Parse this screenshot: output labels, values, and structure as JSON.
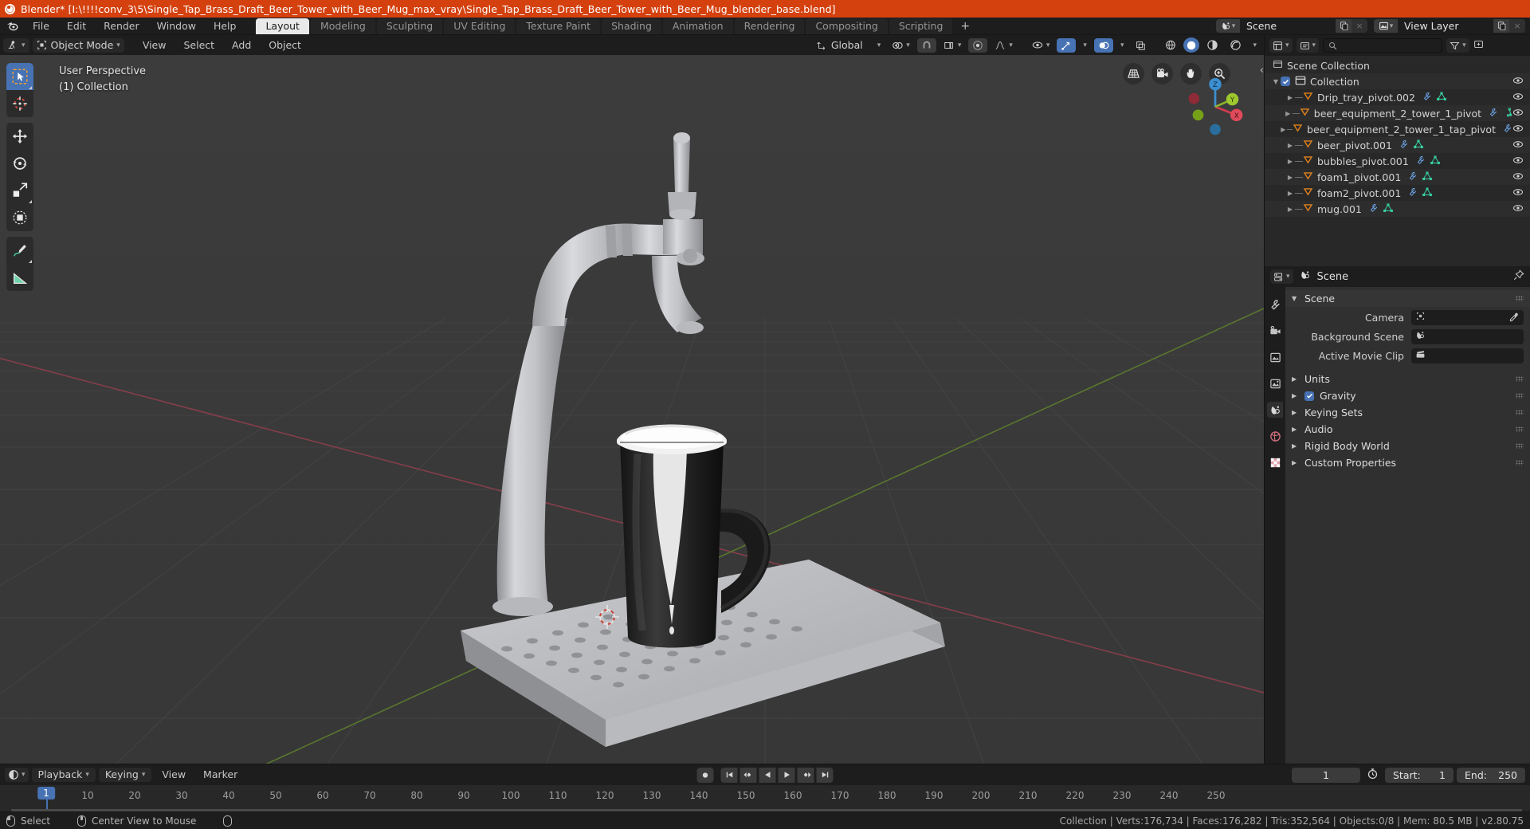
{
  "titlebar": {
    "text": "Blender* [I:\\!!!!conv_3\\5\\Single_Tap_Brass_Draft_Beer_Tower_with_Beer_Mug_max_vray\\Single_Tap_Brass_Draft_Beer_Tower_with_Beer_Mug_blender_base.blend]",
    "bg": "#d4410e"
  },
  "topbar": {
    "menus": [
      "File",
      "Edit",
      "Render",
      "Window",
      "Help"
    ],
    "workspaces": [
      {
        "label": "Layout",
        "active": true
      },
      {
        "label": "Modeling",
        "active": false
      },
      {
        "label": "Sculpting",
        "active": false
      },
      {
        "label": "UV Editing",
        "active": false
      },
      {
        "label": "Texture Paint",
        "active": false
      },
      {
        "label": "Shading",
        "active": false
      },
      {
        "label": "Animation",
        "active": false
      },
      {
        "label": "Rendering",
        "active": false
      },
      {
        "label": "Compositing",
        "active": false
      },
      {
        "label": "Scripting",
        "active": false
      }
    ],
    "add_workspace": "+",
    "scene": {
      "icon": "scene-icon",
      "name": "Scene",
      "new_btn": "new-scene-icon",
      "unlink_btn": "×"
    },
    "view_layer": {
      "icon": "view-layer-icon",
      "name": "View Layer",
      "new_btn": "new-layer-icon",
      "unlink_btn": "×"
    }
  },
  "viewport": {
    "header": {
      "editor_type": "editor-type-3d-view",
      "mode": "Object Mode",
      "menus": [
        "View",
        "Select",
        "Add",
        "Object"
      ],
      "transform_orientation": "Global",
      "pivot_icon": "pivot-point-icon",
      "snap_icon": "snap-magnet-icon",
      "snap_target": "snap-increment-icon",
      "proportional_icon": "proportional-edit-icon",
      "falloff_icon": "falloff-curve-icon"
    },
    "overlay_text_line1": "User Perspective",
    "overlay_text_line2": "(1) Collection",
    "tools": [
      {
        "name": "tweak-select-box-tool",
        "active": true
      },
      {
        "name": "cursor-tool",
        "active": false
      },
      {
        "name": "move-tool",
        "active": false
      },
      {
        "name": "rotate-tool",
        "active": false
      },
      {
        "name": "scale-tool",
        "active": false
      },
      {
        "name": "transform-tool",
        "active": false
      },
      {
        "name": "annotate-tool",
        "active": false
      },
      {
        "name": "measure-tool",
        "active": false
      }
    ],
    "gizmo_buttons": [
      "grid-orthographic-icon",
      "camera-view-icon",
      "pan-view-icon",
      "zoom-view-icon"
    ],
    "nav_axes": {
      "x": "X",
      "y": "Y",
      "z": "Z"
    },
    "collapse_arrow": "‹",
    "shading_modes": [
      "wireframe",
      "solid",
      "material-preview",
      "rendered"
    ],
    "active_shading": "solid"
  },
  "outliner": {
    "display_mode_icon": "outliner-display-mode-icon",
    "filter_icon": "filter-icon",
    "search_placeholder": "",
    "root": "Scene Collection",
    "collection": {
      "label": "Collection",
      "checked": true
    },
    "items": [
      {
        "label": "Drip_tray_pivot.002",
        "icons": [
          "modifier-icon",
          "mesh-data-icon"
        ]
      },
      {
        "label": "beer_equipment_2_tower_1_pivot",
        "icons": [
          "modifier-icon",
          "mesh-data-icon"
        ]
      },
      {
        "label": "beer_equipment_2_tower_1_tap_pivot",
        "icons": [
          "modifier-icon"
        ]
      },
      {
        "label": "beer_pivot.001",
        "icons": [
          "modifier-icon",
          "mesh-data-icon"
        ]
      },
      {
        "label": "bubbles_pivot.001",
        "icons": [
          "modifier-icon",
          "mesh-data-icon"
        ]
      },
      {
        "label": "foam1_pivot.001",
        "icons": [
          "modifier-icon",
          "mesh-data-icon"
        ]
      },
      {
        "label": "foam2_pivot.001",
        "icons": [
          "modifier-icon",
          "mesh-data-icon"
        ]
      },
      {
        "label": "mug.001",
        "icons": [
          "modifier-icon",
          "mesh-data-icon"
        ]
      }
    ]
  },
  "properties": {
    "editor_icon": "properties-editor-icon",
    "breadcrumb_icon": "scene-icon",
    "breadcrumb": "Scene",
    "pin_icon": "pin-icon",
    "tabs": [
      {
        "name": "tool-tab",
        "active": false
      },
      {
        "name": "render-tab",
        "active": false
      },
      {
        "name": "output-tab",
        "active": false
      },
      {
        "name": "view-layer-tab",
        "active": false
      },
      {
        "name": "scene-tab",
        "active": true
      },
      {
        "name": "world-tab",
        "active": false
      },
      {
        "name": "texture-tab",
        "active": false
      }
    ],
    "panels": [
      {
        "label": "Scene",
        "open": true
      },
      {
        "label": "Units",
        "open": false
      },
      {
        "label": "Gravity",
        "open": false,
        "checkbox": true
      },
      {
        "label": "Keying Sets",
        "open": false
      },
      {
        "label": "Audio",
        "open": false
      },
      {
        "label": "Rigid Body World",
        "open": false
      },
      {
        "label": "Custom Properties",
        "open": false
      }
    ],
    "fields": [
      {
        "label": "Camera",
        "icon": "camera-icon",
        "value": "",
        "eyedropper": true
      },
      {
        "label": "Background Scene",
        "icon": "scene-icon",
        "value": "",
        "eyedropper": false
      },
      {
        "label": "Active Movie Clip",
        "icon": "movie-clip-icon",
        "value": "",
        "eyedropper": false
      }
    ]
  },
  "timeline": {
    "editor_icon": "timeline-editor-icon",
    "menus": [
      {
        "label": "Playback",
        "dropdown": true
      },
      {
        "label": "Keying",
        "dropdown": true
      },
      {
        "label": "View",
        "dropdown": false
      },
      {
        "label": "Marker",
        "dropdown": false
      }
    ],
    "playback_buttons": [
      "record-icon",
      "jump-start-icon",
      "prev-keyframe-icon",
      "play-reverse-icon",
      "play-icon",
      "next-keyframe-icon",
      "jump-end-icon"
    ],
    "current_frame": "1",
    "autokey_icon": "auto-keying-icon",
    "start_label": "Start:",
    "start_value": "1",
    "end_label": "End:",
    "end_value": "250",
    "ruler_ticks": [
      "10",
      "20",
      "30",
      "40",
      "50",
      "60",
      "70",
      "80",
      "90",
      "100",
      "110",
      "120",
      "130",
      "140",
      "150",
      "160",
      "170",
      "180",
      "190",
      "200",
      "210",
      "220",
      "230",
      "240",
      "250"
    ],
    "playhead_label": "1"
  },
  "statusbar": {
    "left": [
      {
        "icon": "mouse-left-icon",
        "label": "Select"
      },
      {
        "icon": "mouse-middle-icon",
        "label": "Center View to Mouse"
      },
      {
        "icon": "mouse-right-icon",
        "label": ""
      }
    ],
    "right": "Collection | Verts:176,734 | Faces:176,282 | Tris:352,564 | Objects:0/8 | Mem: 80.5 MB | v2.80.75"
  },
  "colors": {
    "accent": "#4772b3",
    "brand_orange": "#d4410e",
    "object_orange": "#e2821c",
    "mesh_green": "#38d9a9",
    "modifier_blue": "#6a9fe0"
  }
}
